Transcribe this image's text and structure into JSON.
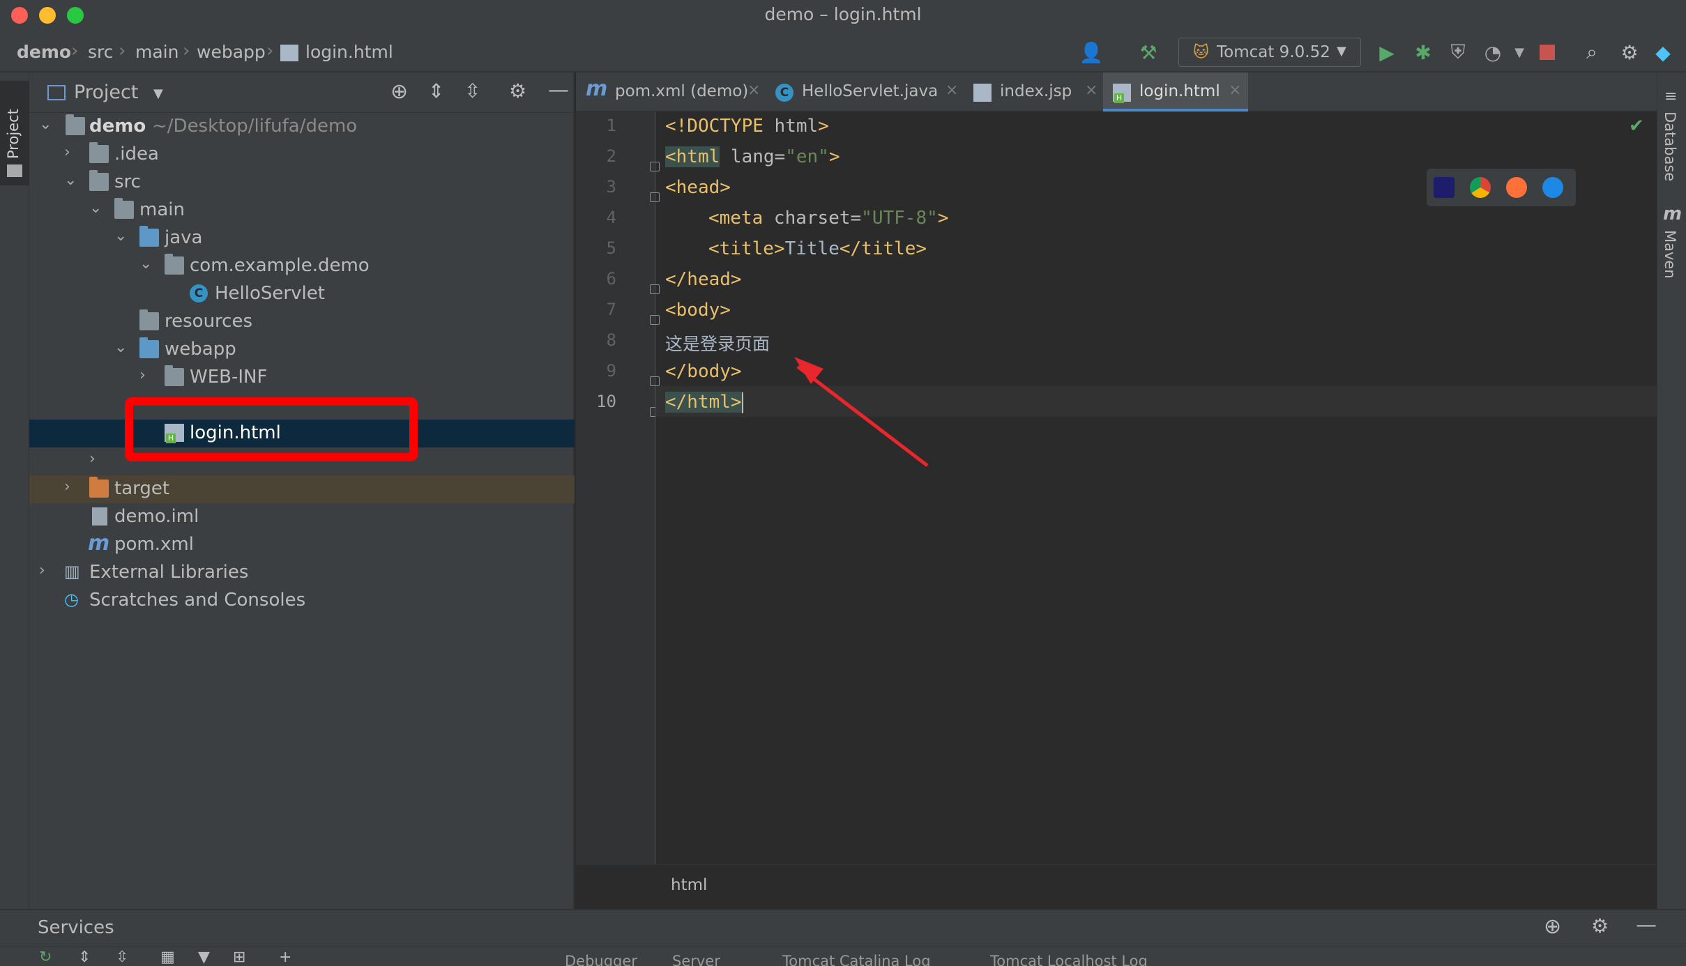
{
  "window": {
    "title": "demo – login.html"
  },
  "navbar": {
    "breadcrumbs": [
      "demo",
      "src",
      "main",
      "webapp",
      "login.html"
    ],
    "run_config": "Tomcat 9.0.52"
  },
  "left_stripe": {
    "project_label": "Project"
  },
  "project_panel": {
    "title": "Project",
    "tree": [
      {
        "label": "demo",
        "hint": "~/Desktop/lifufa/demo"
      },
      {
        "label": ".idea"
      },
      {
        "label": "src"
      },
      {
        "label": "main"
      },
      {
        "label": "java"
      },
      {
        "label": "com.example.demo"
      },
      {
        "label": "HelloServlet"
      },
      {
        "label": "resources"
      },
      {
        "label": "webapp"
      },
      {
        "label": "WEB-INF"
      },
      {
        "label": "login.html"
      },
      {
        "label": "target"
      },
      {
        "label": "demo.iml"
      },
      {
        "label": "pom.xml"
      },
      {
        "label": "External Libraries"
      },
      {
        "label": "Scratches and Consoles"
      }
    ]
  },
  "editor": {
    "tabs": [
      {
        "label": "pom.xml (demo)",
        "icon": "maven-icon"
      },
      {
        "label": "HelloServlet.java",
        "icon": "class-icon"
      },
      {
        "label": "index.jsp",
        "icon": "jsp-icon"
      },
      {
        "label": "login.html",
        "icon": "html-icon",
        "active": true
      }
    ],
    "line_numbers": [
      "1",
      "2",
      "3",
      "4",
      "5",
      "6",
      "7",
      "8",
      "9",
      "10"
    ],
    "code": [
      [
        "<!DOCTYPE ",
        "html",
        ">"
      ],
      [
        "<html",
        " lang=",
        "\"en\"",
        ">"
      ],
      [
        "<head>"
      ],
      [
        "<meta",
        " charset=",
        "\"UTF-8\"",
        ">"
      ],
      [
        "<title>",
        "Title",
        "</title>"
      ],
      [
        "</head>"
      ],
      [
        "<body>"
      ],
      [
        "这是登录页面"
      ],
      [
        "</body>"
      ],
      [
        "</html>"
      ]
    ],
    "status_breadcrumb": "html"
  },
  "right_stripe": {
    "database_label": "Database",
    "maven_label": "Maven"
  },
  "services": {
    "title": "Services",
    "tabs": [
      "Debugger",
      "Server",
      "Tomcat Catalina Log",
      "Tomcat Localhost Log"
    ]
  },
  "colors": {
    "highlight": "#ff0000",
    "arrow": "#e8262b",
    "tag": "#e8bf6a",
    "string": "#6a8759",
    "accent_tab": "#4a88c7",
    "run_green": "#59a869",
    "stop_red": "#c75450"
  }
}
